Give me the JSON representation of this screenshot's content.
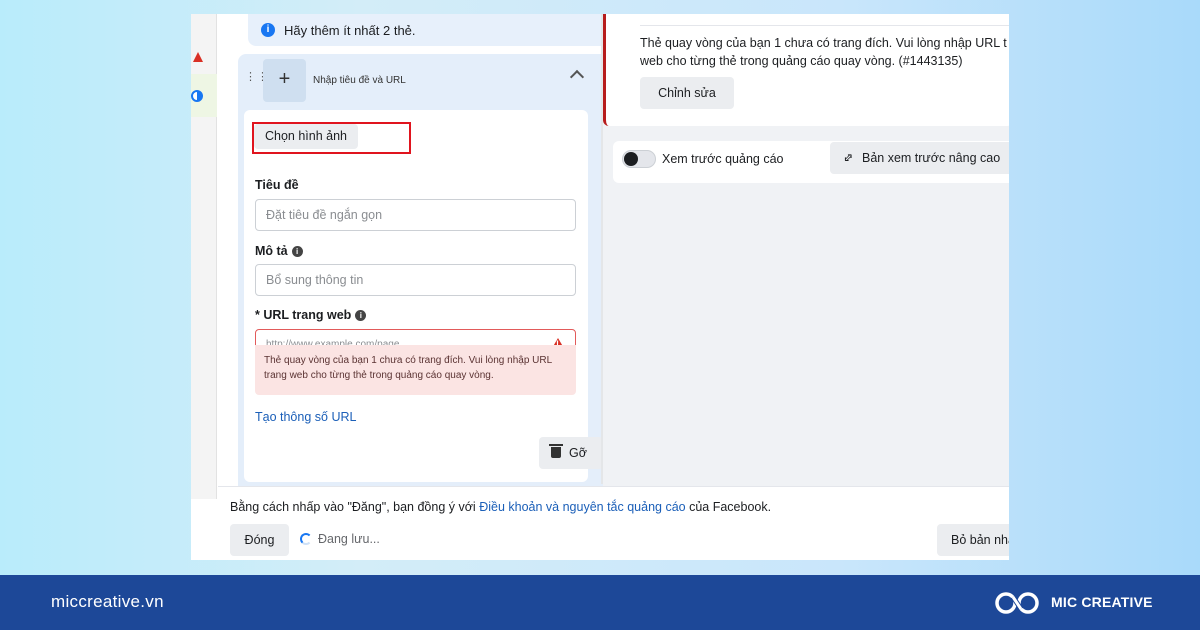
{
  "left_panel": {
    "notice": "Hãy thêm ít nhất 2 thẻ.",
    "card": {
      "add_symbol": "+",
      "header": "Nhập tiêu đề và URL",
      "choose_image": "Chọn hình ảnh",
      "title_label": "Tiêu đề",
      "title_placeholder": "Đặt tiêu đề ngắn gọn",
      "desc_label": "Mô tả",
      "desc_placeholder": "Bổ sung thông tin",
      "url_label": "* URL trang web",
      "url_placeholder": "http://www.example.com/page",
      "url_error": "Thẻ quay vòng của bạn 1 chưa có trang đích. Vui lòng nhập URL trang web cho từng thẻ trong quảng cáo quay vòng.",
      "url_params_link": "Tạo thông số URL",
      "remove_button": "Gỡ"
    }
  },
  "right_panel": {
    "error_line1": "Thẻ quay vòng của bạn 1 chưa có trang đích. Vui lòng nhập URL t",
    "error_line2": "web cho từng thẻ trong quảng cáo quay vòng. (#1443135)",
    "edit_button": "Chỉnh sửa",
    "preview_toggle": "Xem trước quảng cáo",
    "advanced_preview": "Bản xem trước nâng cao"
  },
  "footer": {
    "terms_prefix": "Bằng cách nhấp vào \"Đăng\", bạn đồng ý với",
    "terms_link": "Điều khoản và nguyên tắc quảng cáo",
    "terms_suffix": "của Facebook.",
    "close_button": "Đóng",
    "saving_status": "Đang lưu...",
    "draft_button": "Bỏ bản nhá"
  },
  "brand_bar": {
    "website": "miccreative.vn",
    "brand_name": "MIC CREATIVE"
  },
  "icons": {
    "info": "info-icon",
    "alert": "warning-triangle-icon",
    "trash": "trash-icon",
    "expand": "expand-arrows-icon",
    "collapse": "chevron-up-icon",
    "drag": "drag-handle-icon"
  },
  "colors": {
    "primary_blue": "#1877f2",
    "error_red": "#e0141e",
    "link_blue": "#1b5fb8",
    "brand_bar": "#1d4898"
  }
}
